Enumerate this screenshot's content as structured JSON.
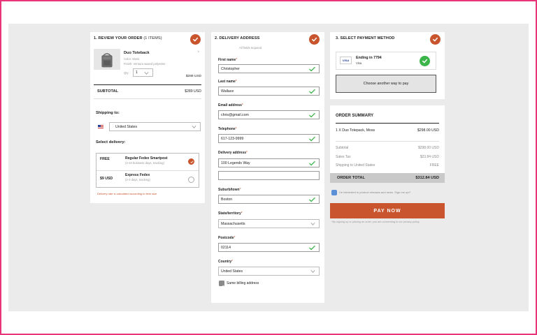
{
  "review": {
    "title": "1. Review your order",
    "count": "(1 items)",
    "product_name": "Duo Totebaack",
    "product_name_display": "Duo Toteback",
    "color_label": "Color:",
    "color_value": "Moss",
    "finish_label": "Finish:",
    "finish_value": "Ventura waxed polyester",
    "qty_label": "Qty:",
    "qty_value": "1",
    "item_price": "$289 USD",
    "subtotal_label": "SUBTOTAL",
    "subtotal_value": "$289 USD",
    "shipping_to_label": "Shipping to:",
    "country_value": "United States",
    "select_delivery_label": "Select delivery:",
    "options": [
      {
        "price": "FREE",
        "name": "Regular Fedex Smartpost",
        "detail": "(3-10 business days, tracking)",
        "selected": true
      },
      {
        "price": "$9 USD",
        "name": "Express Fedex",
        "detail": "(2-3 days, tracking)",
        "selected": false
      }
    ],
    "delivery_note": "Delivery rate is calculated according to item size"
  },
  "delivery": {
    "title": "2. Delivery address",
    "required_note": "All fields required",
    "fields": {
      "first_name": {
        "label": "First name",
        "value": "Christopher"
      },
      "last_name": {
        "label": "Last name",
        "value": "Wallace"
      },
      "email": {
        "label": "Email address",
        "value": "chris@gmail.com"
      },
      "telephone": {
        "label": "Telephone",
        "value": "617-123-9999"
      },
      "address": {
        "label": "Delivery address",
        "value": "100 Legends Way",
        "value2": ""
      },
      "suburb": {
        "label": "Suburb/town",
        "value": "Boston"
      },
      "state": {
        "label": "State/territory",
        "value": "Massachusetts"
      },
      "postcode": {
        "label": "Postcode",
        "value": "02114"
      },
      "country": {
        "label": "Country",
        "value": "United States"
      }
    },
    "same_billing_label": "Same billing address"
  },
  "payment": {
    "title": "3. Select payment method",
    "card_brand": "VISA",
    "card_ending": "Ending in 7794",
    "card_type": "Visa",
    "alt_button": "Choose another way to pay"
  },
  "summary": {
    "title": "ORDER SUMMARY",
    "line_item": "1 X Duo Totepack, Moss",
    "line_price": "$298.00 USD",
    "subtotal_label": "Subtotal",
    "subtotal_value": "$298.00 USD",
    "tax_label": "Sales Tax",
    "tax_value": "$23.84 USD",
    "ship_label": "Shipping to United States",
    "ship_value": "FREE",
    "total_label": "ORDER TOTAL",
    "total_value": "$312.84 USD",
    "newsletter": "I'm interested in product releases and news. Sign me up!*",
    "pay_button": "PAY NOW",
    "terms": "*By signing up or placing an order, you are consenting to our privacy policy."
  },
  "colors": {
    "accent": "#c8552d",
    "success": "#3bb54a",
    "canvas": "#ebebeb",
    "frame": "#e8357a"
  }
}
